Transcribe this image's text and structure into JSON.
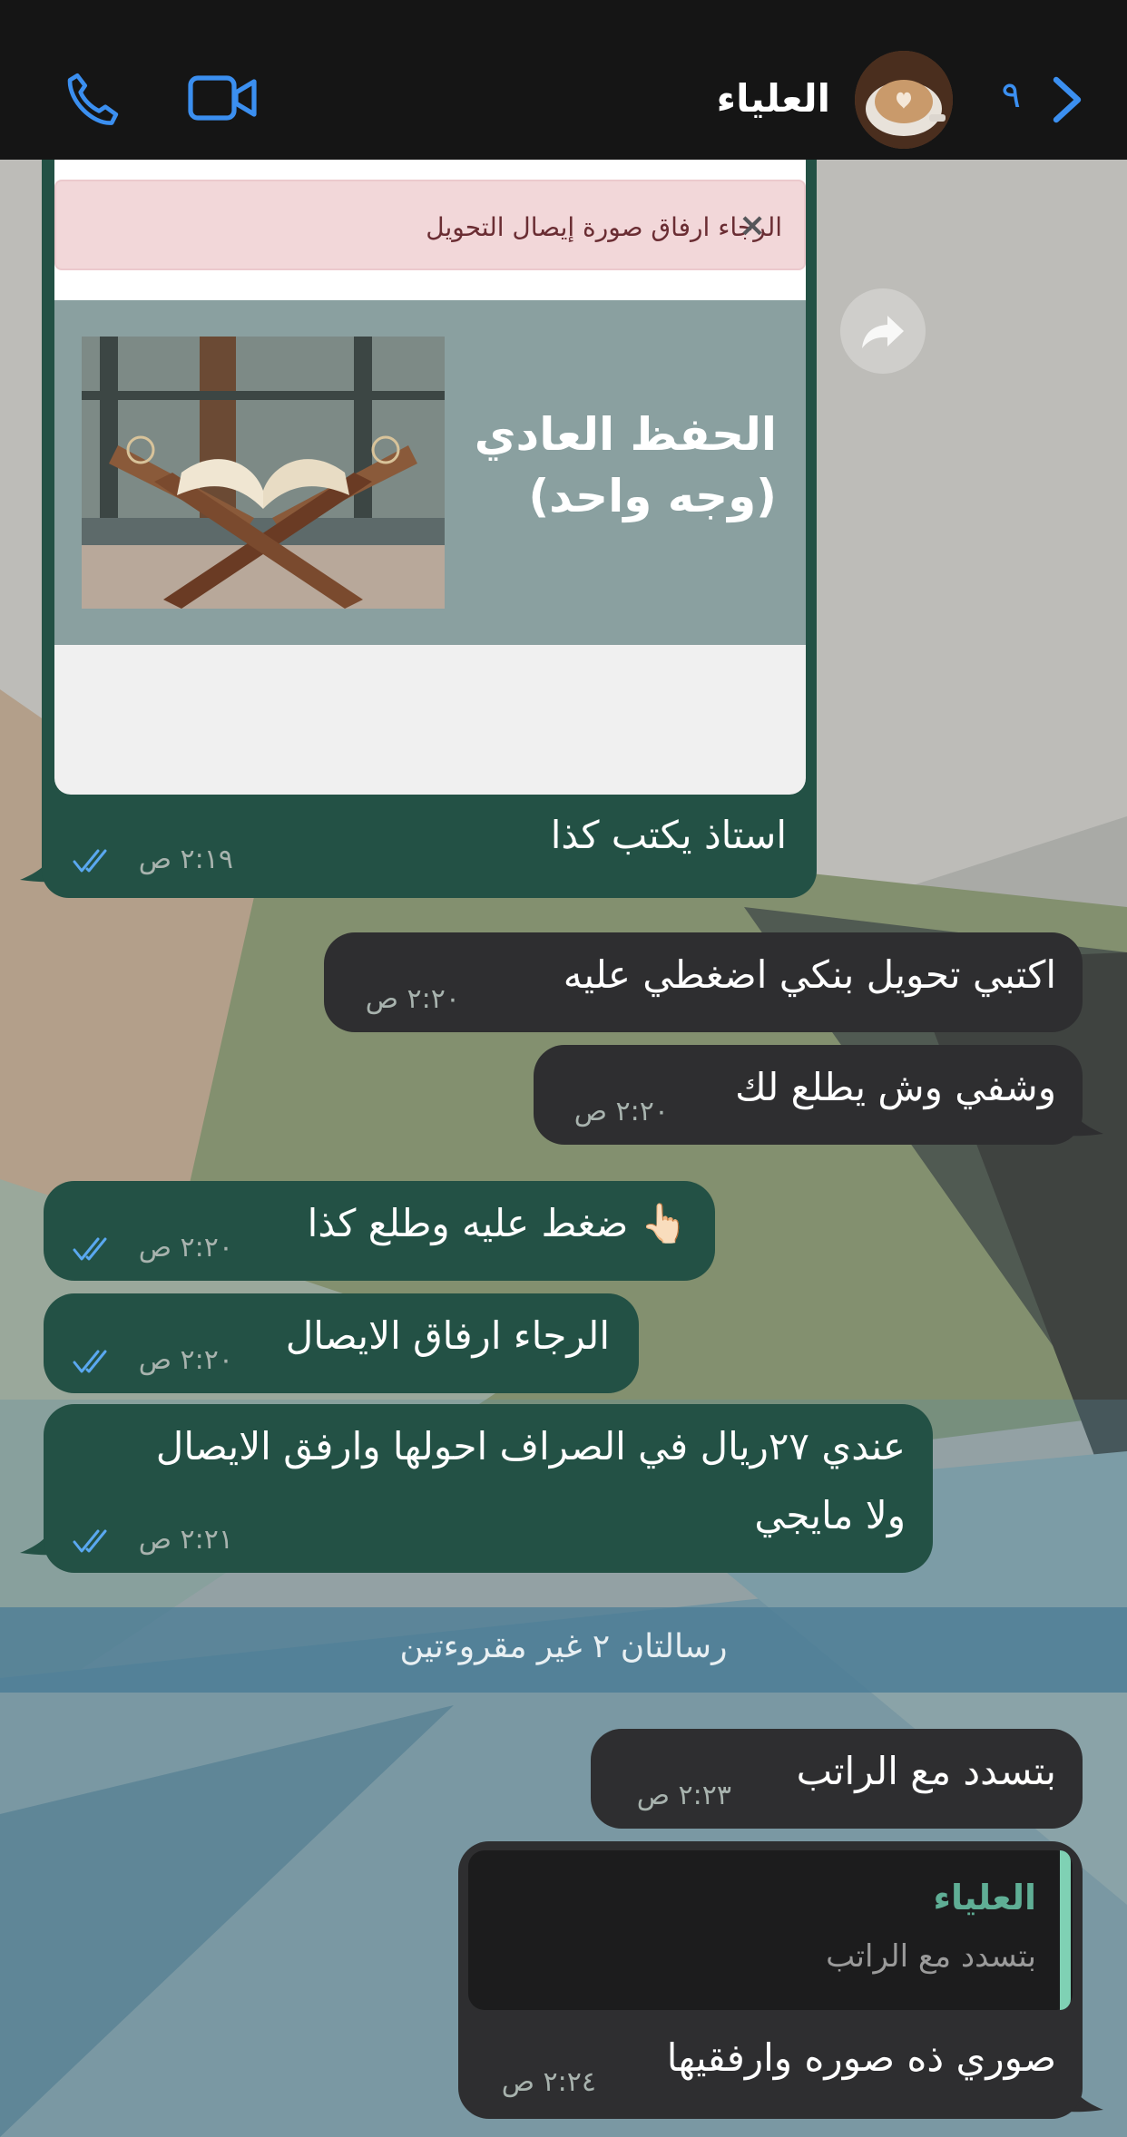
{
  "header": {
    "contact_name": "العلياء",
    "unread_count": "٩"
  },
  "card": {
    "alert_text": "الرجاء ارفاق صورة إيصال التحويل",
    "alert_close": "×",
    "promo_title_line1": "الحفظ العادي",
    "promo_title_line2": "(وجه واحد)"
  },
  "messages": [
    {
      "direction": "outgoing",
      "text": "استاذ يكتب كذا",
      "time": "٢:١٩ ص",
      "read": true
    },
    {
      "direction": "incoming",
      "text": "اكتبي تحويل بنكي اضغطي عليه",
      "time": "٢:٢٠ ص"
    },
    {
      "direction": "incoming",
      "text": "وشفي وش يطلع لك",
      "time": "٢:٢٠ ص"
    },
    {
      "direction": "outgoing",
      "text": "ضغط عليه وطلع كذا 👆🏻",
      "time": "٢:٢٠ ص",
      "read": true
    },
    {
      "direction": "outgoing",
      "text": "الرجاء ارفاق الايصال",
      "time": "٢:٢٠ ص",
      "read": true
    },
    {
      "direction": "outgoing",
      "text_line1": "عندي ٢٧ريال في الصراف احولها وارفق الايصال",
      "text_line2": "ولا مايجي",
      "time": "٢:٢١ ص",
      "read": true
    },
    {
      "direction": "incoming",
      "text": "بتسدد مع الراتب",
      "time": "٢:٢٣ ص"
    },
    {
      "direction": "incoming",
      "text": "صوري ذه صوره وارفقيها",
      "time": "٢:٢٤ ص",
      "reply_to": {
        "name": "العلياء",
        "text": "بتسدد مع الراتب"
      }
    }
  ],
  "unread_divider": "رسالتان ٢ غير مقروءتين",
  "colors": {
    "outgoing_bubble": "#235145",
    "incoming_bubble": "#2e2e30",
    "accent_blue": "#3b8ff0",
    "header_bg": "#151515"
  }
}
